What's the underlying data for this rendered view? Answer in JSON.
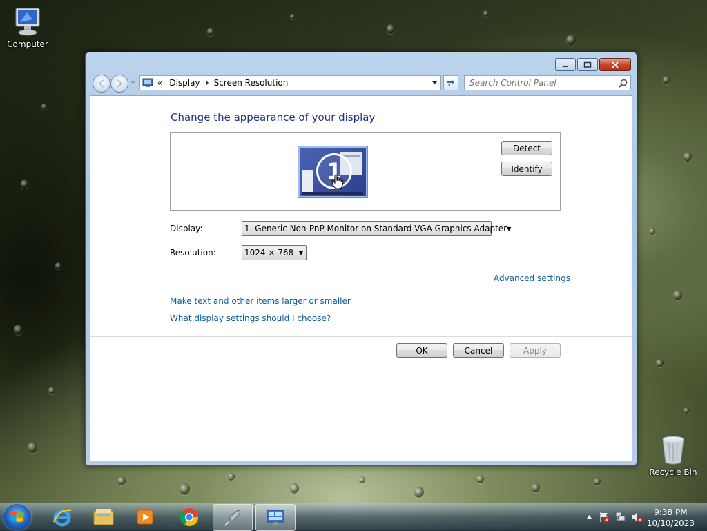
{
  "desktop": {
    "computer_label": "Computer",
    "recycle_label": "Recycle Bin"
  },
  "window": {
    "breadcrumb": [
      "Display",
      "Screen Resolution"
    ],
    "breadcrumb_prefix": "«",
    "search_placeholder": "Search Control Panel",
    "heading": "Change the appearance of your display",
    "monitor_number": "1",
    "detect_label": "Detect",
    "identify_label": "Identify",
    "display_label": "Display:",
    "display_value": "1. Generic Non-PnP Monitor on Standard VGA Graphics Adapter",
    "resolution_label": "Resolution:",
    "resolution_value": "1024 × 768",
    "advanced_link": "Advanced settings",
    "link_text_size": "Make text and other items larger or smaller",
    "link_help": "What display settings should I choose?",
    "ok_label": "OK",
    "cancel_label": "Cancel",
    "apply_label": "Apply"
  },
  "taskbar": {
    "time": "9:38 PM",
    "date": "10/10/2023",
    "pinned": [
      "internet-explorer",
      "file-explorer",
      "media-player",
      "chrome",
      "rocket-app",
      "control-panel"
    ]
  },
  "colors": {
    "heading": "#1e3287",
    "link": "#0b5e99"
  }
}
